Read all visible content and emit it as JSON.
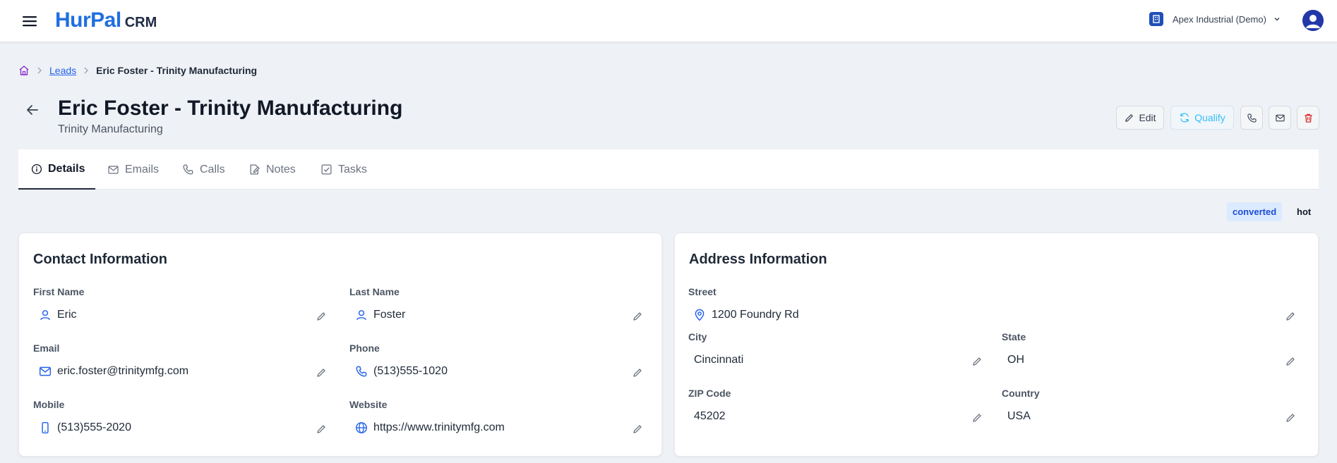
{
  "app": {
    "logo_main": "HurPal",
    "logo_sub": "CRM"
  },
  "org": {
    "name": "Apex Industrial (Demo)"
  },
  "breadcrumb": {
    "leads": "Leads",
    "current": "Eric Foster - Trinity Manufacturing"
  },
  "header": {
    "title": "Eric Foster - Trinity Manufacturing",
    "subtitle": "Trinity Manufacturing"
  },
  "actions": {
    "edit": "Edit",
    "qualify": "Qualify"
  },
  "tabs": [
    "Details",
    "Emails",
    "Calls",
    "Notes",
    "Tasks"
  ],
  "badges": {
    "status": "converted",
    "rating": "hot"
  },
  "contact": {
    "title": "Contact Information",
    "first_name": {
      "label": "First Name",
      "value": "Eric"
    },
    "last_name": {
      "label": "Last Name",
      "value": "Foster"
    },
    "email": {
      "label": "Email",
      "value": "eric.foster@trinitymfg.com"
    },
    "phone": {
      "label": "Phone",
      "value": "(513)555-1020"
    },
    "mobile": {
      "label": "Mobile",
      "value": "(513)555-2020"
    },
    "website": {
      "label": "Website",
      "value": "https://www.trinitymfg.com"
    }
  },
  "address": {
    "title": "Address Information",
    "street": {
      "label": "Street",
      "value": "1200 Foundry Rd"
    },
    "city": {
      "label": "City",
      "value": "Cincinnati"
    },
    "state": {
      "label": "State",
      "value": "OH"
    },
    "zip": {
      "label": "ZIP Code",
      "value": "45202"
    },
    "country": {
      "label": "Country",
      "value": "USA"
    }
  },
  "colors": {
    "brand": "#1f6fe0",
    "accent_link": "#2563eb",
    "danger": "#dc2626",
    "qualify": "#38bdf8",
    "badge_bg": "#dbeafe"
  },
  "icons": [
    "menu-icon",
    "org-building-icon",
    "chevron-down-icon",
    "user-avatar-icon",
    "home-icon",
    "chevron-right-icon",
    "arrow-left-icon",
    "pencil-icon",
    "refresh-icon",
    "phone-icon",
    "mail-icon",
    "trash-icon",
    "info-icon",
    "user-icon",
    "smartphone-icon",
    "globe-icon",
    "map-pin-icon"
  ]
}
